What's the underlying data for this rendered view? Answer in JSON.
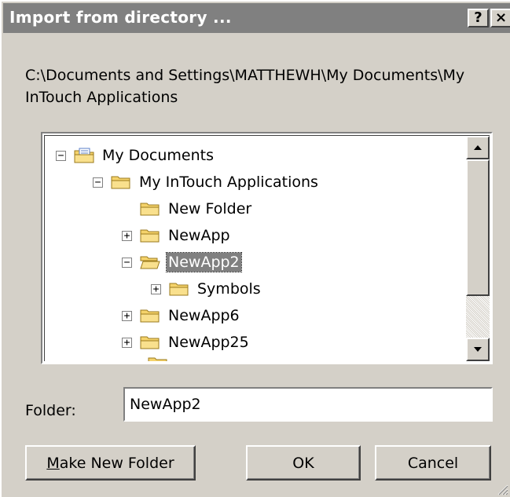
{
  "dialog": {
    "title": "Import from directory ...",
    "help_label": "?",
    "close_label": "×",
    "path": "C:\\Documents and Settings\\MATTHEWH\\My Documents\\My InTouch Applications"
  },
  "tree": {
    "items": [
      {
        "label": "My Documents",
        "expander": "−"
      },
      {
        "label": "My InTouch Applications",
        "expander": "−"
      },
      {
        "label": "New Folder",
        "expander": ""
      },
      {
        "label": "NewApp",
        "expander": "+"
      },
      {
        "label": "NewApp2",
        "expander": "−",
        "selected": true
      },
      {
        "label": "Symbols",
        "expander": "+"
      },
      {
        "label": "NewApp6",
        "expander": "+"
      },
      {
        "label": "NewApp25",
        "expander": "+"
      }
    ]
  },
  "folder": {
    "label": "Folder:",
    "value": "NewApp2"
  },
  "buttons": {
    "make_new_folder_mnemonic": "M",
    "make_new_folder_rest": "ake New Folder",
    "ok": "OK",
    "cancel": "Cancel"
  },
  "colors": {
    "titlebar": "#808080",
    "dialog_bg": "#d4d0c8",
    "selection": "#808080",
    "folder_yellow": "#f5d36b"
  },
  "icons": {
    "my_documents": "documents-folder-icon",
    "folder": "folder-icon",
    "scroll_up": "arrow-up-icon",
    "scroll_down": "arrow-down-icon",
    "resize": "resize-grip-icon"
  }
}
